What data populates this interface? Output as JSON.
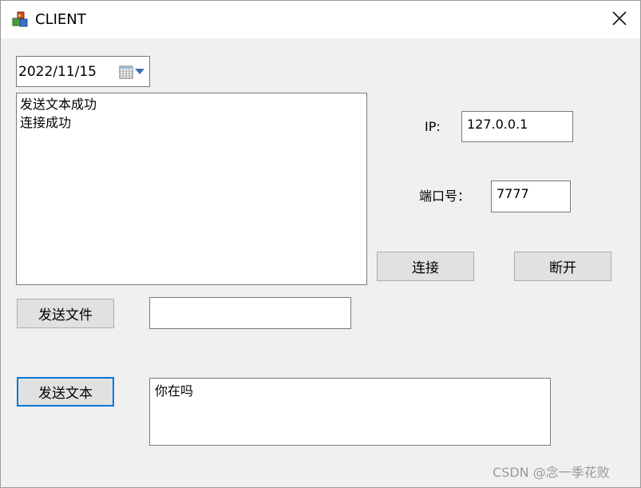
{
  "window": {
    "title": "CLIENT",
    "icon": "app-cubes-icon",
    "close_icon": "close-icon"
  },
  "date_picker": {
    "value": "2022/11/15",
    "icon": "calendar-icon",
    "dropdown_icon": "chevron-down-icon"
  },
  "log": {
    "lines": [
      "发送文本成功",
      "连接成功"
    ]
  },
  "connection": {
    "ip_label": "IP:",
    "ip_value": "127.0.0.1",
    "port_label": "端口号：",
    "port_value": "7777",
    "connect_label": "连接",
    "disconnect_label": "断开"
  },
  "send_file": {
    "button_label": "发送文件",
    "path_value": ""
  },
  "send_text": {
    "button_label": "发送文本",
    "message_value": "你在吗"
  },
  "watermark": "CSDN @念一季花败",
  "colors": {
    "window_bg": "#f0f0f0",
    "titlebar_bg": "#ffffff",
    "button_bg": "#e1e1e1",
    "focus_border": "#0078d7",
    "accent_arrow": "#3b6fb4"
  }
}
